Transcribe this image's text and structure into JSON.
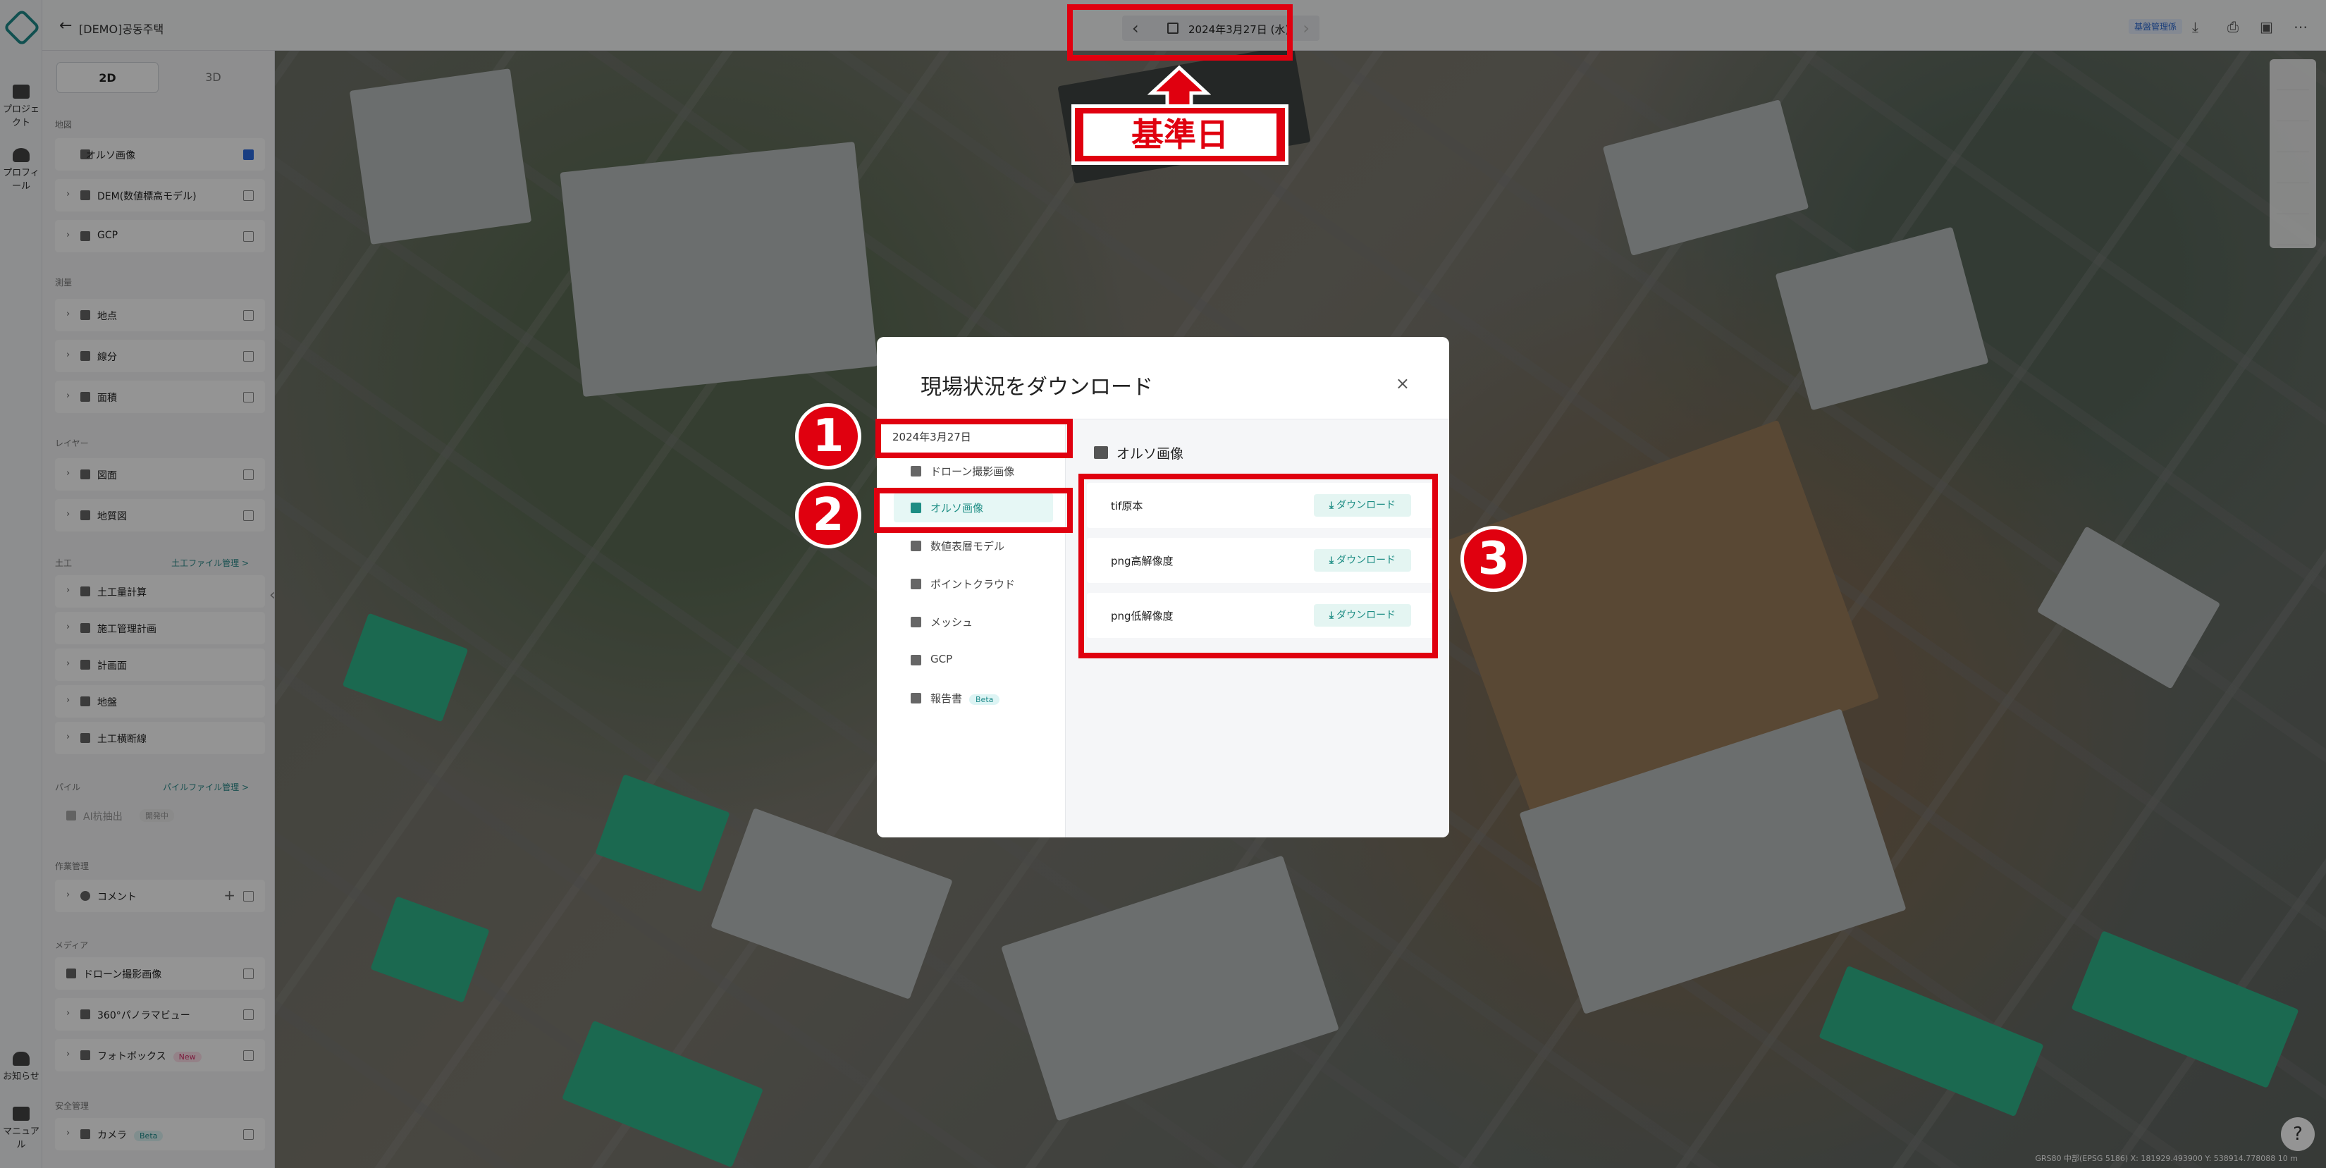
{
  "topbar": {
    "project": "[DEMO]공동주택",
    "date_label": "2024年3月27日 (水)",
    "mgmt_label": "基盤管理係"
  },
  "rail": {
    "project_label": "プロジェクト",
    "profile_label": "プロフィール",
    "notice_label": "お知らせ",
    "manual_label": "マニュアル"
  },
  "sidebar": {
    "mode_2d": "2D",
    "mode_3d": "3D",
    "sec_map": "地図",
    "ortho": "オルソ画像",
    "dem": "DEM(数値標高モデル)",
    "gcp": "GCP",
    "sec_measure": "測量",
    "point": "地点",
    "line": "線分",
    "area": "面積",
    "sec_layer": "レイヤー",
    "drawing": "図面",
    "terrain": "地質図",
    "sec_earth": "土工",
    "earth_link": "土工ファイル管理 >",
    "earth_plan": "土工量計算",
    "construct_plan": "施工管理計画",
    "plan_surface": "計画面",
    "ground": "地盤",
    "earth_section": "土工横断線",
    "sec_pile": "パイル",
    "pile_link": "パイルファイル管理 >",
    "pile_item": "AI杭抽出",
    "pile_badge": "開発中",
    "sec_work": "作業管理",
    "comment": "コメント",
    "sec_media": "メディア",
    "drone_img": "ドローン撮影画像",
    "panorama": "360°パノラマビュー",
    "photobox": "フォトボックス",
    "new_badge": "New",
    "sec_safety": "安全管理",
    "camera": "カメラ",
    "beta_badge": "Beta"
  },
  "modal": {
    "title": "現場状況をダウンロード",
    "close": "×",
    "date": "2024年3月27日",
    "menu": [
      {
        "label": "ドローン撮影画像"
      },
      {
        "label": "オルソ画像"
      },
      {
        "label": "数値表層モデル"
      },
      {
        "label": "ポイントクラウド"
      },
      {
        "label": "メッシュ"
      },
      {
        "label": "GCP"
      },
      {
        "label": "報告書",
        "badge": "Beta"
      }
    ],
    "panel_title": "オルソ画像",
    "downloads": [
      {
        "label": "tif原本",
        "button": "ダウンロード"
      },
      {
        "label": "png高解像度",
        "button": "ダウンロード"
      },
      {
        "label": "png低解像度",
        "button": "ダウンロード"
      }
    ]
  },
  "annotations": {
    "callout": "基準日",
    "n1": "1",
    "n2": "2",
    "n3": "3"
  },
  "map": {
    "scale_text": "GRS80 中部(EPSG 5186)   X: 181929.493900   Y: 538914.778088   10 m",
    "help": "?"
  },
  "colors": {
    "accent": "#1d8d84",
    "annotation_red": "#e0000f",
    "checkbox_blue": "#2b6ce0"
  }
}
